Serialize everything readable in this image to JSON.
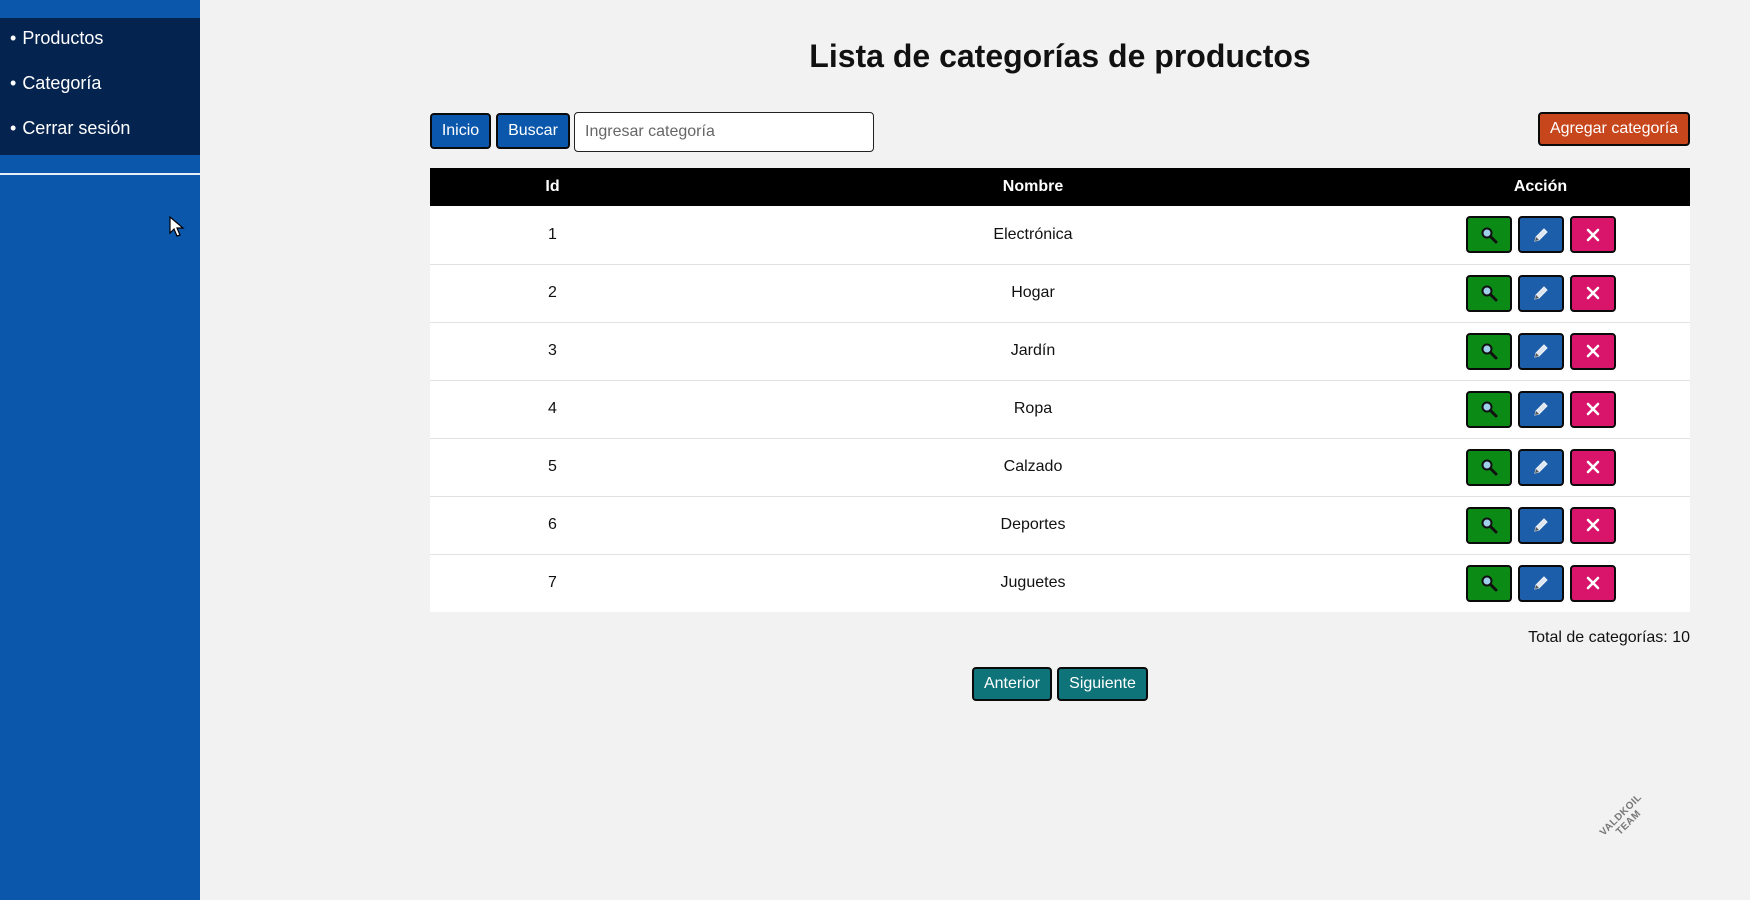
{
  "sidebar": {
    "items": [
      {
        "label": "Productos"
      },
      {
        "label": "Categoría"
      },
      {
        "label": "Cerrar sesión"
      }
    ],
    "bullet": "•",
    "colors": {
      "background": "#0b57ab",
      "menu": "#05234f"
    }
  },
  "header": {
    "title": "Lista de categorías de productos"
  },
  "toolbar": {
    "home_label": "Inicio",
    "search_label": "Buscar",
    "search_placeholder": "Ingresar categoría",
    "search_value": "",
    "add_label": "Agregar categoría"
  },
  "table": {
    "columns": [
      "Id",
      "Nombre",
      "Acción"
    ],
    "rows": [
      {
        "id": "1",
        "name": "Electrónica"
      },
      {
        "id": "2",
        "name": "Hogar"
      },
      {
        "id": "3",
        "name": "Jardín"
      },
      {
        "id": "4",
        "name": "Ropa"
      },
      {
        "id": "5",
        "name": "Calzado"
      },
      {
        "id": "6",
        "name": "Deportes"
      },
      {
        "id": "7",
        "name": "Juguetes"
      }
    ],
    "action_icons": [
      "search-icon",
      "pencil-icon",
      "close-icon"
    ]
  },
  "footer": {
    "total_text": "Total de categorías: 10",
    "prev_label": "Anterior",
    "next_label": "Siguiente"
  },
  "watermark": {
    "line1": "VALDKOIL",
    "line2": "TEAM"
  },
  "colors": {
    "primary": "#0b57ab",
    "add": "#c8461c",
    "pager": "#0f7479",
    "view": "#0b8a16",
    "edit": "#1d5eab",
    "delete": "#d8156b"
  }
}
